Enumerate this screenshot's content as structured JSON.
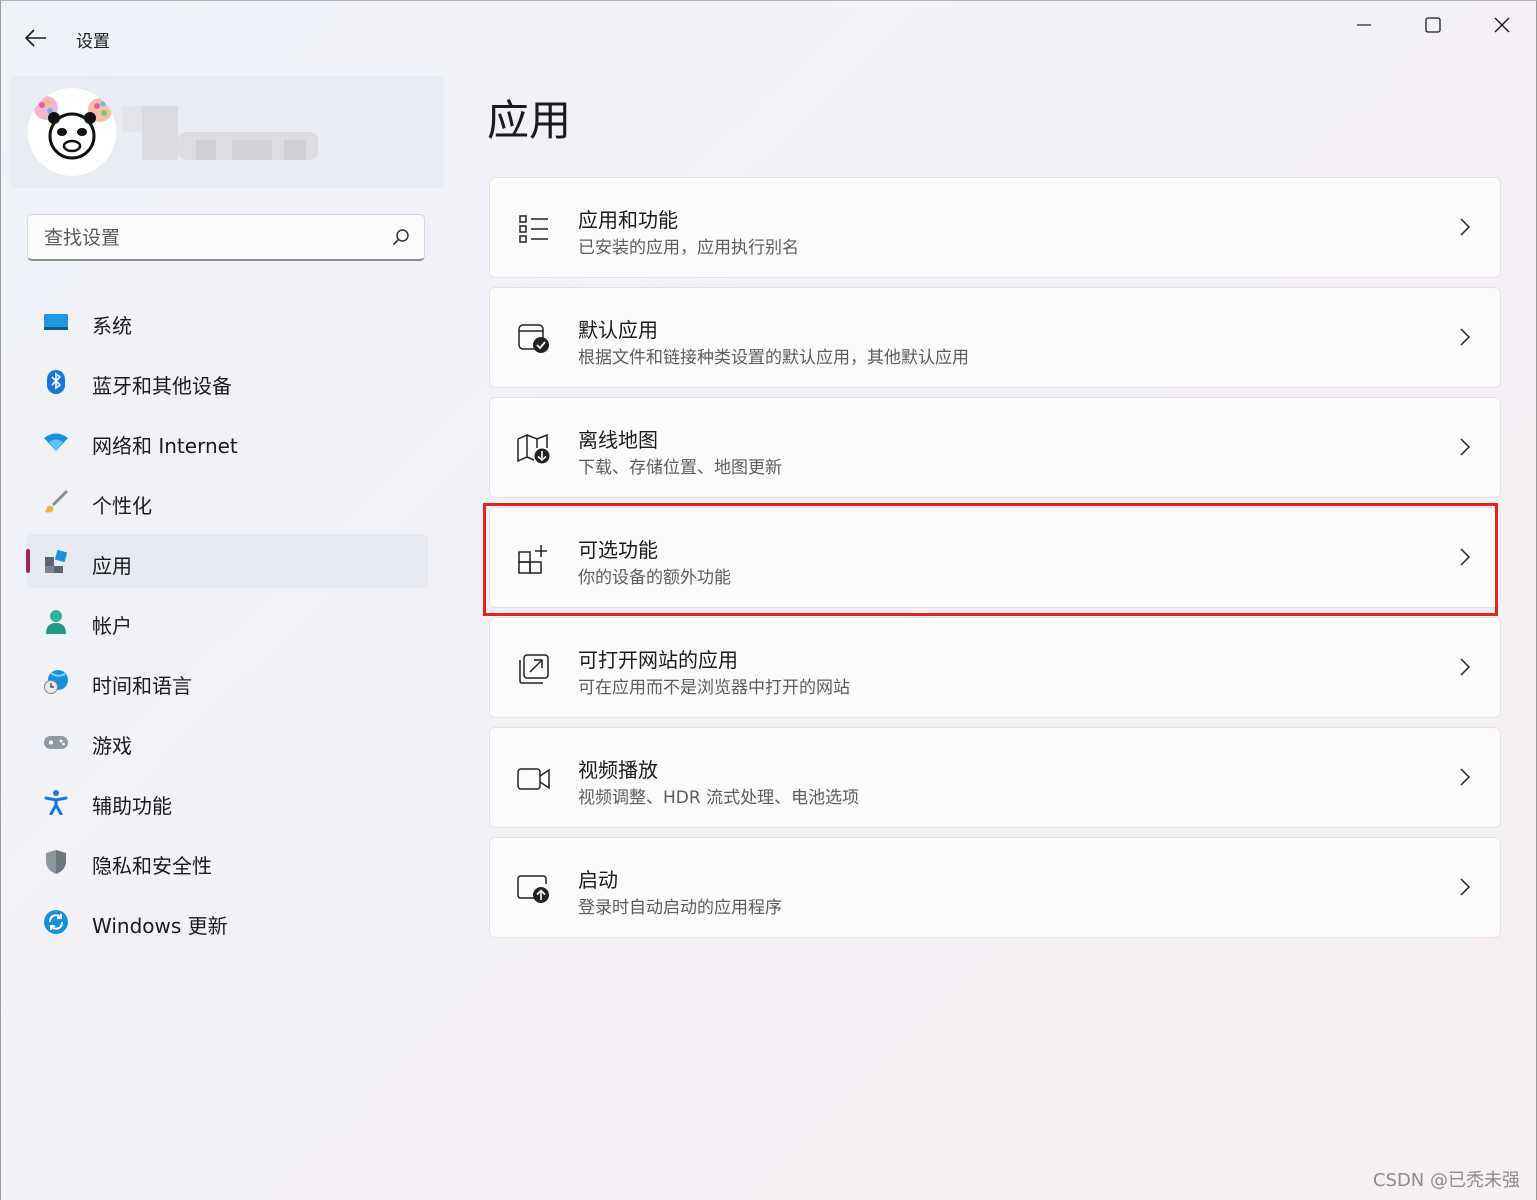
{
  "window": {
    "title": "设置",
    "accent": "#0067c0",
    "nav_indicator_color": "#9b2a5b",
    "highlight_color": "#e52421"
  },
  "search": {
    "placeholder": "查找设置"
  },
  "nav": {
    "items": [
      {
        "label": "系统",
        "icon": "monitor-icon"
      },
      {
        "label": "蓝牙和其他设备",
        "icon": "bluetooth-icon"
      },
      {
        "label": "网络和 Internet",
        "icon": "wifi-icon"
      },
      {
        "label": "个性化",
        "icon": "brush-icon"
      },
      {
        "label": "应用",
        "icon": "apps-icon",
        "active": true
      },
      {
        "label": "帐户",
        "icon": "person-icon"
      },
      {
        "label": "时间和语言",
        "icon": "globe-clock-icon"
      },
      {
        "label": "游戏",
        "icon": "gamepad-icon"
      },
      {
        "label": "辅助功能",
        "icon": "accessibility-icon"
      },
      {
        "label": "隐私和安全性",
        "icon": "shield-icon"
      },
      {
        "label": "Windows 更新",
        "icon": "update-icon"
      }
    ]
  },
  "main": {
    "title": "应用",
    "cards": [
      {
        "title": "应用和功能",
        "subtitle": "已安装的应用，应用执行别名",
        "icon": "list-icon"
      },
      {
        "title": "默认应用",
        "subtitle": "根据文件和链接种类设置的默认应用，其他默认应用",
        "icon": "default-apps-icon"
      },
      {
        "title": "离线地图",
        "subtitle": "下载、存储位置、地图更新",
        "icon": "offline-map-icon"
      },
      {
        "title": "可选功能",
        "subtitle": "你的设备的额外功能",
        "icon": "optional-features-icon",
        "highlighted": true
      },
      {
        "title": "可打开网站的应用",
        "subtitle": "可在应用而不是浏览器中打开的网站",
        "icon": "open-website-icon"
      },
      {
        "title": "视频播放",
        "subtitle": "视频调整、HDR 流式处理、电池选项",
        "icon": "video-camera-icon"
      },
      {
        "title": "启动",
        "subtitle": "登录时自动启动的应用程序",
        "icon": "startup-icon"
      }
    ]
  },
  "watermark": "CSDN @已秃未强"
}
